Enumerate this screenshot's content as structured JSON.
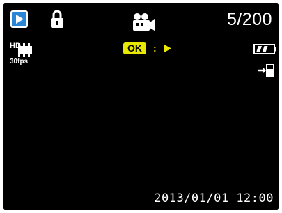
{
  "status_bar": {
    "mode_icon": "playback-icon",
    "protect_icon": "lock-icon",
    "media_type_icon": "video-camera-icon",
    "file_counter": "5/200"
  },
  "video_info": {
    "resolution_label": "HD",
    "frame_rate": "30fps"
  },
  "hint": {
    "ok_label": "OK",
    "separator": ":",
    "action_icon": "play-icon"
  },
  "battery": {
    "icon": "battery-icon",
    "level_fraction": 0.66
  },
  "storage": {
    "icon": "memory-card-icon"
  },
  "footer": {
    "datetime": "2013/01/01 12:00"
  },
  "colors": {
    "background": "#000000",
    "text": "#ffffff",
    "accent_blue": "#2b86d6",
    "accent_yellow": "#e8e800"
  }
}
